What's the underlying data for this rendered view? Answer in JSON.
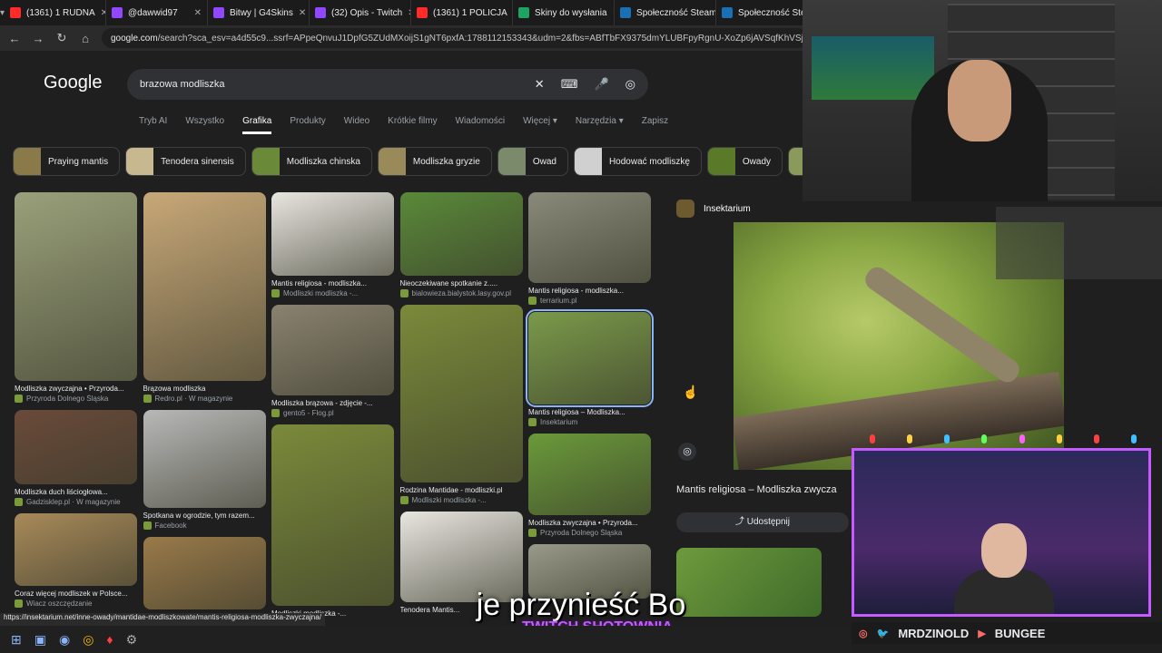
{
  "tabs": [
    {
      "label": "(1361) 1 RUDNA",
      "color": "#ff2a2a"
    },
    {
      "label": "@dawwid97",
      "color": "#9146ff"
    },
    {
      "label": "Bitwy | G4Skins",
      "color": "#9146ff"
    },
    {
      "label": "(32) Opis - Twitch",
      "color": "#9146ff"
    },
    {
      "label": "(1361) 1 POLICJA",
      "color": "#ff2a2a"
    },
    {
      "label": "Skiny do wysłania",
      "color": "#1ea362"
    },
    {
      "label": "Społeczność Steam",
      "color": "#1b6fb5"
    },
    {
      "label": "Społeczność Steam",
      "color": "#1b6fb5"
    }
  ],
  "address": {
    "host": "google.com",
    "path": "/search?sca_esv=a4d55c9...ssrf=APpeQnvuJ1DpfG5ZUdMXoijS1gNT6pxfA:1788112153343&udm=2&fbs=ABfTbFX9375dmYLUBFpyRgnU-XoZp6jAVSqfKhVSjM"
  },
  "google": {
    "logo": "Google",
    "query": "brazowa modliszka",
    "tabs": [
      "Tryb AI",
      "Wszystko",
      "Grafika",
      "Produkty",
      "Wideo",
      "Krótkie filmy",
      "Wiadomości",
      "Więcej ▾",
      "Narzędzia ▾",
      "Zapisz"
    ],
    "active_tab": "Grafika"
  },
  "chips": [
    {
      "label": "Praying mantis",
      "color": "#8a7a4a"
    },
    {
      "label": "Tenodera sinensis",
      "color": "#c8b890"
    },
    {
      "label": "Modliszka chinska",
      "color": "#6a8a3a"
    },
    {
      "label": "Modliszka gryzie",
      "color": "#9a8a5a"
    },
    {
      "label": "Owad",
      "color": "#7a8a6a"
    },
    {
      "label": "Hodować modliszkę",
      "color": "#d0d0d0"
    },
    {
      "label": "Owady",
      "color": "#5a7a2a"
    },
    {
      "label": "",
      "color": "#8a9a5a"
    }
  ],
  "results": {
    "col1": [
      {
        "title": "Modliszka zwyczajna • Przyroda...",
        "source": "Przyroda Dolnego Śląska",
        "color": "#9aa07a",
        "h": 208
      },
      {
        "title": "Modliszka duch liściogłowa...",
        "source": "Gadzisklep.pl · W magazynie",
        "color": "#6a4a3a",
        "h": 82
      },
      {
        "title": "Coraz więcej modliszek w Polsce...",
        "source": "Wiacz oszczędzanie",
        "color": "#a88a5a",
        "h": 80
      }
    ],
    "col2": [
      {
        "title": "Brązowa modliszka",
        "source": "Redro.pl · W magazynie",
        "color": "#c8a878",
        "h": 208
      },
      {
        "title": "Spotkana w ogrodzie, tym razem...",
        "source": "Facebook",
        "color": "#b8b8b8",
        "h": 108
      },
      {
        "title": "",
        "source": "",
        "color": "#9a7a4a",
        "h": 80
      }
    ],
    "col3": [
      {
        "title": "Mantis religiosa - modliszka...",
        "source": "Modliszki modliszka -...",
        "color": "#e8e6e0",
        "h": 92
      },
      {
        "title": "Modliszka brązowa - zdjęcie -...",
        "source": "gento5 - Flog.pl",
        "color": "#8a8270",
        "h": 100
      },
      {
        "title": "Modliszki modliszka -...",
        "source": "",
        "color": "#7a8a3a",
        "h": 200
      }
    ],
    "col4": [
      {
        "title": "Nieoczekiwane spotkanie z.....",
        "source": "bialowieza.bialystok.lasy.gov.pl",
        "color": "#5a8a3a",
        "h": 92
      },
      {
        "title": "Rodzina Mantidae - modliszki.pl",
        "source": "Modliszki modliszka -...",
        "color": "#7a8a3a",
        "h": 196
      },
      {
        "title": "Tenodera Mantis...",
        "source": "",
        "color": "#e8e6e0",
        "h": 100
      }
    ],
    "col5": [
      {
        "title": "Mantis religiosa - modliszka...",
        "source": "terrarium.pl",
        "color": "#8a8a7a",
        "h": 100
      },
      {
        "title": "Mantis religiosa – Modliszka...",
        "source": "Insektarium",
        "color": "#7a9a4a",
        "h": 102,
        "selected": true
      },
      {
        "title": "Modliszka zwyczajna • Przyroda...",
        "source": "Przyroda Dolnego Śląska",
        "color": "#6a9a3a",
        "h": 90
      },
      {
        "title": "",
        "source": "",
        "color": "#9a9a8a",
        "h": 60
      }
    ]
  },
  "preview": {
    "site": "Insektarium",
    "caption": "Mantis religiosa – Modliszka zwycza",
    "share": "Udostępnij"
  },
  "overlay": {
    "subtitle": "je przynieść Bo",
    "brand": "TWITCH SHOTOWNIA",
    "social_left": "MRDZINOLD",
    "social_right": "BUNGEE"
  },
  "status_url": "https://insektarium.net/inne-owady/mantidae-modliszkowate/mantis-religiosa-modliszka-zwyczajna/"
}
